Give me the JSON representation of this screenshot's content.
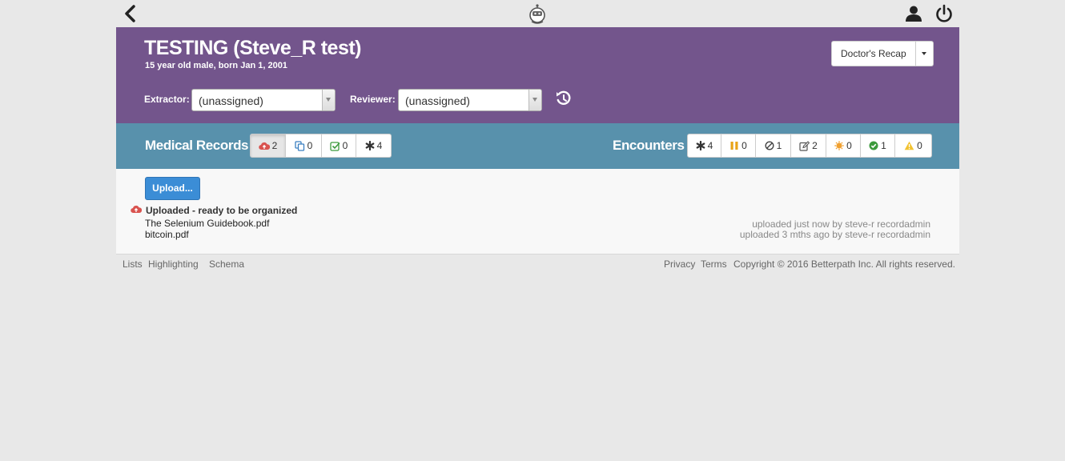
{
  "topbar": {
    "back_icon": "chevron-left-icon",
    "logo_icon": "robot-logo-icon",
    "user_icon": "user-icon",
    "power_icon": "power-icon"
  },
  "header": {
    "patient_name": "TESTING (Steve_R test)",
    "patient_info": "15 year old male, born Jan 1, 2001",
    "recap_label": "Doctor's Recap",
    "extractor_label": "Extractor:",
    "extractor_value": "(unassigned)",
    "reviewer_label": "Reviewer:",
    "reviewer_value": "(unassigned)",
    "history_icon": "history-icon",
    "color": "#73558c"
  },
  "medical_records": {
    "title": "Medical Records",
    "buttons": [
      {
        "icon": "cloud-upload-icon",
        "count": "2",
        "active": true
      },
      {
        "icon": "copy-icon",
        "count": "0"
      },
      {
        "icon": "check-square-icon",
        "count": "0"
      },
      {
        "icon": "asterisk-icon",
        "count": "4"
      }
    ]
  },
  "encounters": {
    "title": "Encounters",
    "buttons": [
      {
        "icon": "asterisk-icon",
        "count": "4"
      },
      {
        "icon": "pause-icon",
        "count": "0"
      },
      {
        "icon": "ban-icon",
        "count": "1"
      },
      {
        "icon": "edit-icon",
        "count": "2"
      },
      {
        "icon": "sun-icon",
        "count": "0"
      },
      {
        "icon": "check-circle-icon",
        "count": "1"
      },
      {
        "icon": "warning-icon",
        "count": "0"
      }
    ]
  },
  "toolbar_color": "#5891ac",
  "upload": {
    "button_label": "Upload...",
    "group_label": "Uploaded - ready to be organized",
    "files": [
      {
        "name": "The Selenium Guidebook.pdf",
        "meta": "uploaded just now by steve-r recordadmin"
      },
      {
        "name": "bitcoin.pdf",
        "meta": "uploaded 3 mths ago by steve-r recordadmin"
      }
    ]
  },
  "footer": {
    "links_left": [
      "Lists",
      "Highlighting",
      "Schema"
    ],
    "links_right": [
      "Privacy",
      "Terms"
    ],
    "copyright": "Copyright © 2016 Betterpath Inc. All rights reserved."
  }
}
